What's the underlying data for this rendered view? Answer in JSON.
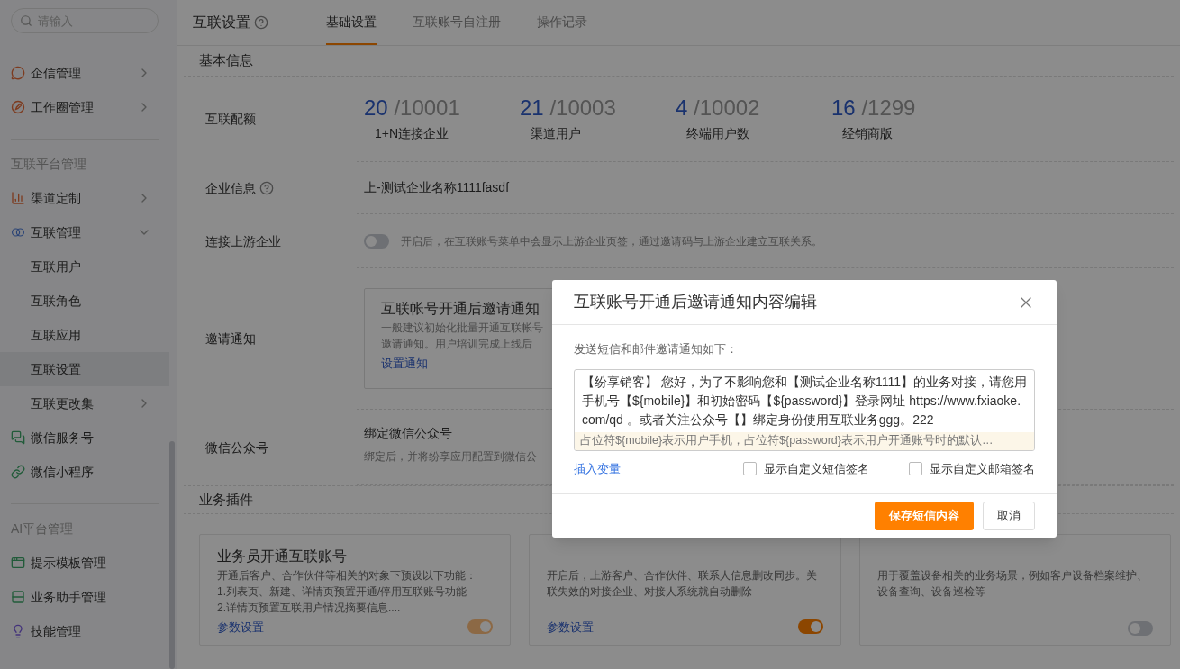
{
  "sidebar": {
    "search": {
      "placeholder": "请输入"
    },
    "groups": [
      {
        "items": [
          {
            "label": "企信管理",
            "expanded": false
          },
          {
            "label": "工作圈管理",
            "expanded": false
          }
        ]
      },
      {
        "title": "互联平台管理",
        "items": [
          {
            "label": "渠道定制",
            "expanded": false
          },
          {
            "label": "互联管理",
            "expanded": true,
            "children": [
              {
                "label": "互联用户",
                "selected": false
              },
              {
                "label": "互联角色",
                "selected": false
              },
              {
                "label": "互联应用",
                "selected": false
              },
              {
                "label": "互联设置",
                "selected": true
              },
              {
                "label": "互联更改集",
                "selected": false,
                "expanded": false
              }
            ]
          },
          {
            "label": "微信服务号"
          },
          {
            "label": "微信小程序"
          }
        ]
      },
      {
        "title": "AI平台管理",
        "items": [
          {
            "label": "提示模板管理"
          },
          {
            "label": "业务助手管理"
          },
          {
            "label": "技能管理"
          }
        ]
      }
    ]
  },
  "header": {
    "title": "互联设置",
    "tabs": [
      {
        "label": "基础设置",
        "selected": true
      },
      {
        "label": "互联账号自注册",
        "selected": false
      },
      {
        "label": "操作记录",
        "selected": false
      }
    ]
  },
  "basic_info": {
    "heading": "基本信息",
    "quota": {
      "label": "互联配额",
      "stats": [
        {
          "used": "20",
          "total": "/10001",
          "caption": "1+N连接企业"
        },
        {
          "used": "21",
          "total": "/10003",
          "caption": "渠道用户"
        },
        {
          "used": "4",
          "total": "/10002",
          "caption": "终端用户数"
        },
        {
          "used": "16",
          "total": "/1299",
          "caption": "经销商版"
        }
      ]
    },
    "company": {
      "label": "企业信息",
      "value": "上-测试企业名称1111fasdf"
    },
    "upstream": {
      "label": "连接上游企业",
      "on": false,
      "hint": "开启后，在互联账号菜单中会显示上游企业页签，通过邀请码与上游企业建立互联关系。"
    },
    "invite": {
      "label": "邀请通知",
      "card_title": "互联帐号开通后邀请通知",
      "lines": [
        "一般建议初始化批量开通互联帐号",
        "邀请通知。用户培训完成上线后"
      ],
      "link": "设置通知"
    },
    "wechat": {
      "label": "微信公众号",
      "title": "绑定微信公众号",
      "hint": "绑定后，并将纷享应用配置到微信公"
    }
  },
  "plugins": {
    "heading": "业务插件",
    "cards": [
      {
        "title": "业务员开通互联账号",
        "lines": [
          "开通后客户、合作伙伴等相关的对象下预设以下功能：",
          "1.列表页、新建、详情页预置开通/停用互联账号功能",
          "2.详情页预置互联用户情况摘要信息...."
        ],
        "link": "参数设置",
        "on": true,
        "disabled": true
      },
      {
        "lines": [
          "开启后，上游客户、合作伙伴、联系人信息删改同步。关联失效的对接企业、对接人系统就自动删除"
        ],
        "link": "参数设置",
        "on": true,
        "disabled": false
      },
      {
        "lines": [
          "用于覆盖设备相关的业务场景，例如客户设备档案维护、设备查询、设备巡检等"
        ],
        "on": false,
        "disabled": false
      }
    ]
  },
  "dialog": {
    "title": "互联账号开通后邀请通知内容编辑",
    "intro": "发送短信和邮件邀请通知如下：",
    "message": "【纷享销客】 您好，为了不影响您和【测试企业名称1111】的业务对接，请您用手机号【${mobile}】和初始密码【${password}】登录网址 https://www.fxiaoke.com/qd 。或者关注公众号【】绑定身份使用互联业务ggg。222",
    "tip": "占位符${mobile}表示用户手机，占位符${password}表示用户开通账号时的默认…",
    "insert_link": "插入变量",
    "options": [
      {
        "label": "显示自定义短信签名",
        "checked": false
      },
      {
        "label": "显示自定义邮箱签名",
        "checked": false
      }
    ],
    "buttons": [
      {
        "label": "保存短信内容",
        "kind": "primary"
      },
      {
        "label": "取消",
        "kind": "secondary"
      }
    ]
  }
}
